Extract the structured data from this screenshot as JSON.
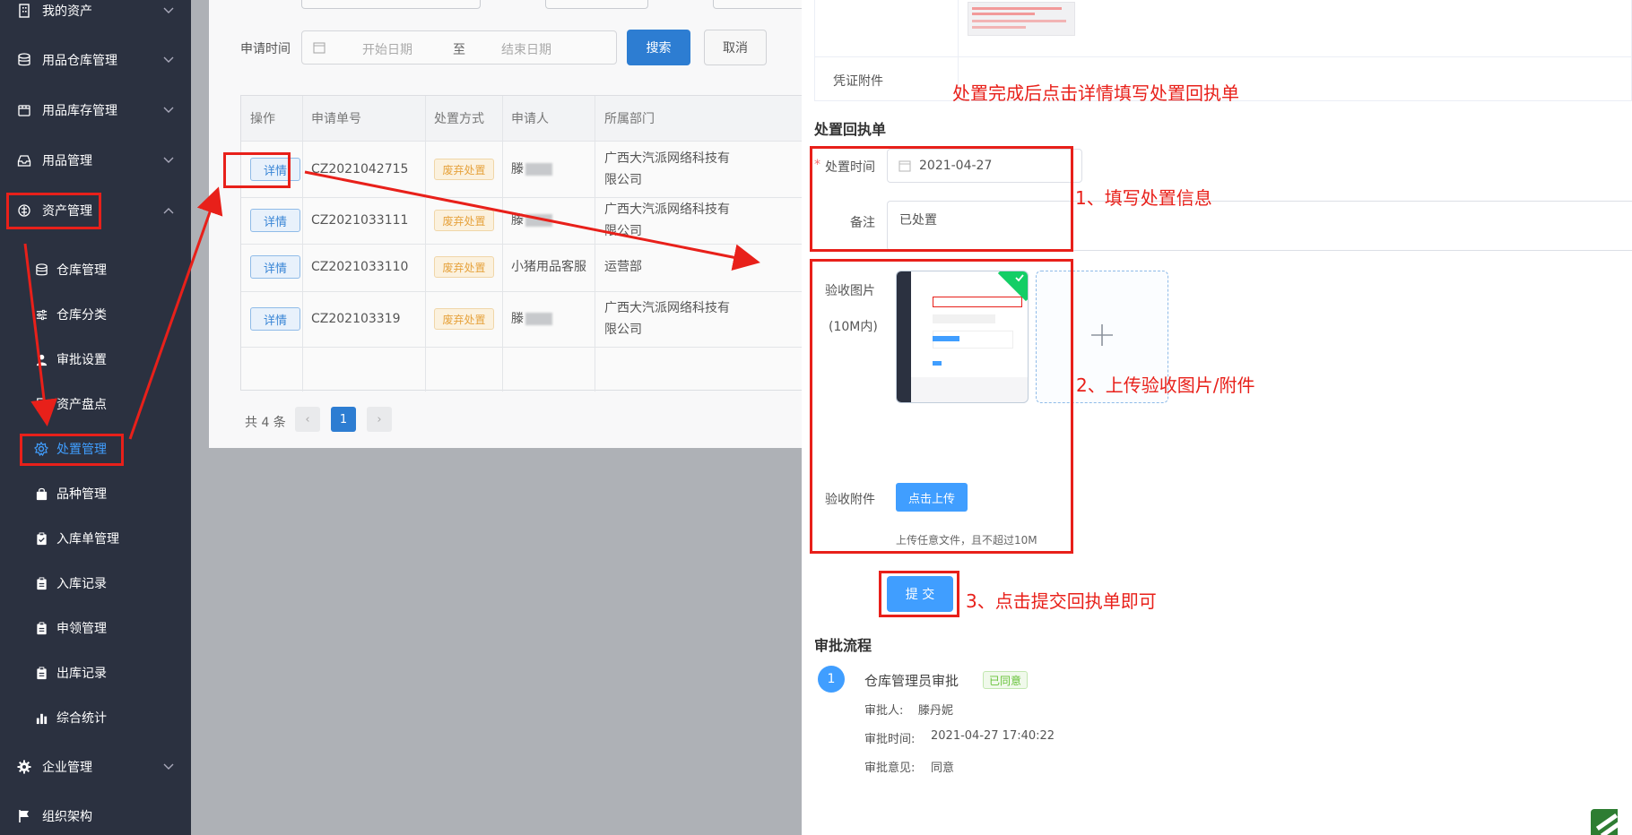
{
  "sidebar": {
    "items": [
      {
        "label": "我的资产",
        "icon": "building-icon"
      },
      {
        "label": "用品仓库管理",
        "icon": "database-icon"
      },
      {
        "label": "用品库存管理",
        "icon": "box-icon"
      },
      {
        "label": "用品管理",
        "icon": "inbox-icon"
      },
      {
        "label": "资产管理",
        "icon": "asset-icon"
      },
      {
        "label": "企业管理",
        "icon": "gear-icon"
      },
      {
        "label": "组织架构",
        "icon": "flag-icon"
      }
    ],
    "sub_items": [
      {
        "label": "仓库管理",
        "icon": "database-icon"
      },
      {
        "label": "仓库分类",
        "icon": "sliders-icon"
      },
      {
        "label": "审批设置",
        "icon": "user-icon"
      },
      {
        "label": "资产盘点",
        "icon": "document-icon"
      },
      {
        "label": "处置管理",
        "icon": "gear-outline-icon"
      },
      {
        "label": "品种管理",
        "icon": "bag-icon"
      },
      {
        "label": "入库单管理",
        "icon": "clipboard-check-icon"
      },
      {
        "label": "入库记录",
        "icon": "clipboard-icon"
      },
      {
        "label": "申领管理",
        "icon": "clipboard-icon"
      },
      {
        "label": "出库记录",
        "icon": "clipboard-icon"
      },
      {
        "label": "综合统计",
        "icon": "bar-chart-icon"
      }
    ]
  },
  "filter": {
    "label": "申请时间",
    "start_placeholder": "开始日期",
    "separator": "至",
    "end_placeholder": "结束日期",
    "search_label": "搜索",
    "cancel_label": "取消"
  },
  "table": {
    "headers": [
      "操作",
      "申请单号",
      "处置方式",
      "申请人",
      "所属部门"
    ],
    "rows": [
      {
        "action": "详情",
        "no": "CZ2021042715",
        "method": "废弃处置",
        "applicant": "滕",
        "dept": "广西大汽派网络科技有限公司"
      },
      {
        "action": "详情",
        "no": "CZ2021033111",
        "method": "废弃处置",
        "applicant": "滕",
        "dept": "广西大汽派网络科技有限公司"
      },
      {
        "action": "详情",
        "no": "CZ2021033110",
        "method": "废弃处置",
        "applicant": "小猪用品客服",
        "dept": "运营部"
      },
      {
        "action": "详情",
        "no": "CZ202103319",
        "method": "废弃处置",
        "applicant": "滕",
        "dept": "广西大汽派网络科技有限公司"
      }
    ]
  },
  "pagination": {
    "total": "共 4 条",
    "prev": "‹",
    "current": "1",
    "next": "›"
  },
  "drawer": {
    "voucher_label": "凭证附件",
    "receipt_title": "处置回执单",
    "time_label": "处置时间",
    "time_value": "2021-04-27",
    "remark_label": "备注",
    "remark_value": "已处置",
    "image_label": "验收图片",
    "image_hint": "(10M内)",
    "attach_label": "验收附件",
    "upload_label": "点击上传",
    "upload_tip": "上传任意文件，且不超过10M",
    "submit_label": "提 交",
    "flow_title": "审批流程",
    "flow": {
      "step": "1",
      "name": "仓库管理员审批",
      "status": "已同意",
      "approver_label": "审批人:",
      "approver": "滕丹妮",
      "time_label": "审批时间:",
      "time": "2021-04-27 17:40:22",
      "opinion_label": "审批意见:",
      "opinion": "同意"
    }
  },
  "annotations": {
    "top": "处置完成后点击详情填写处置回执单",
    "step1": "1、填写处置信息",
    "step2": "2、上传验收图片/附件",
    "step3": "3、点击提交回执单即可"
  },
  "colors": {
    "sidebar_bg": "#2b3140",
    "accent": "#409eff",
    "annotation_red": "#e8201a",
    "tag_orange": "#e6a23c",
    "success_green": "#67c23a"
  }
}
